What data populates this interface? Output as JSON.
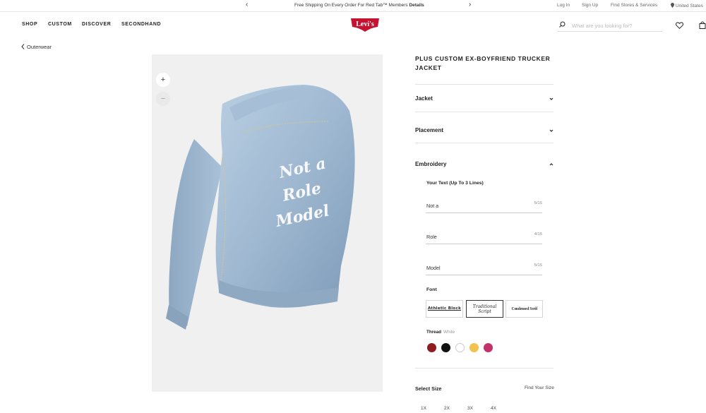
{
  "promo": {
    "message": "Free Shipping On Every Order For Red Tab™ Members",
    "details_link": "Details",
    "prev_arrow": "‹",
    "next_arrow": "›",
    "login": "Log In",
    "signup": "Sign Up",
    "find_stores": "Find Stores & Services",
    "region": "United States"
  },
  "nav": {
    "items": [
      "SHOP",
      "CUSTOM",
      "DISCOVER",
      "SECONDHAND"
    ],
    "logo_text": "Levi's",
    "brand_color": "#c41230"
  },
  "search": {
    "placeholder": "What are you looking for?"
  },
  "breadcrumb": {
    "back_label": "Outerwear"
  },
  "gallery": {
    "zoom_in": "+",
    "zoom_out": "−",
    "embroidery_lines": [
      "Not a",
      "Role",
      "Model"
    ]
  },
  "product": {
    "title": "PLUS CUSTOM EX-BOYFRIEND TRUCKER JACKET"
  },
  "accordion": {
    "jacket": "Jacket",
    "placement": "Placement",
    "embroidery": "Embroidery"
  },
  "embroidery": {
    "text_heading": "Your Text (Up To 3 Lines)",
    "lines": [
      {
        "value": "Not a",
        "count": "5/15"
      },
      {
        "value": "Role",
        "count": "4/15"
      },
      {
        "value": "Model",
        "count": "5/15"
      }
    ],
    "font_heading": "Font",
    "fonts": [
      {
        "name": "Athletic Block"
      },
      {
        "name": "Traditional Script"
      },
      {
        "name": "Condensed Serif"
      }
    ],
    "thread_heading": "Thread",
    "thread_selected": "White",
    "thread_colors": [
      "#8e1d22",
      "#111111",
      "#ffffff",
      "#f2c14e",
      "#c3306a"
    ]
  },
  "size": {
    "label": "Select Size",
    "find_size": "Find Your Size",
    "options": [
      "1X",
      "2X",
      "3X",
      "4X"
    ]
  }
}
